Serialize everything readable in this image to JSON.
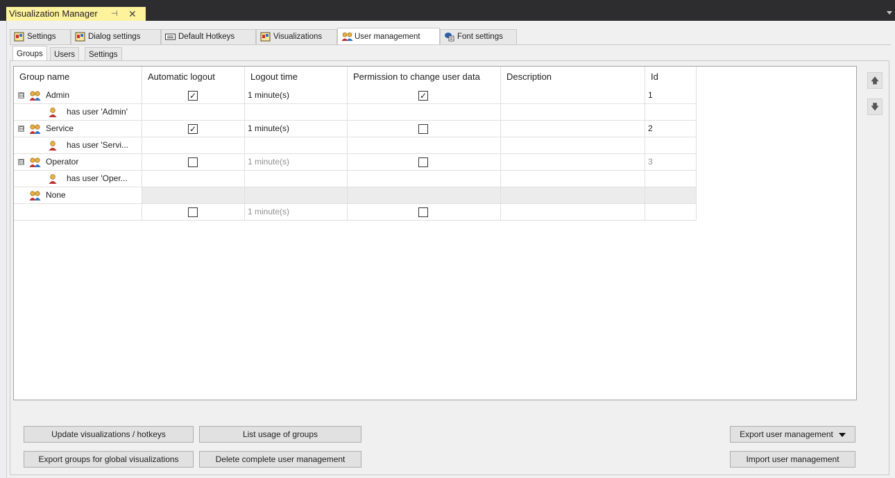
{
  "window": {
    "doc_tab_title": "Visualization Manager",
    "pin_glyph": "⊣",
    "close_glyph": "✕"
  },
  "top_tabs": [
    {
      "label": "Settings",
      "icon": "visualization-settings-icon"
    },
    {
      "label": "Dialog settings",
      "icon": "dialog-settings-icon"
    },
    {
      "label": "Default Hotkeys",
      "icon": "keyboard-icon"
    },
    {
      "label": "Visualizations",
      "icon": "visualizations-icon"
    },
    {
      "label": "User management",
      "icon": "user-group-icon",
      "active": true
    },
    {
      "label": "Font settings",
      "icon": "font-settings-icon"
    }
  ],
  "sub_tabs": [
    {
      "label": "Groups",
      "active": true
    },
    {
      "label": "Users"
    },
    {
      "label": "Settings"
    }
  ],
  "grid": {
    "columns": [
      "Group name",
      "Automatic logout",
      "Logout time",
      "Permission to change user data",
      "Description",
      "Id"
    ],
    "rows": [
      {
        "type": "group",
        "expander": "⊟",
        "name": "Admin",
        "auto_logout": true,
        "logout_time": "1 minute(s)",
        "perm_change": true,
        "description": "",
        "id": "1",
        "dim": false
      },
      {
        "type": "user",
        "name": "has user 'Admin'"
      },
      {
        "type": "group",
        "expander": "⊟",
        "name": "Service",
        "auto_logout": true,
        "logout_time": "1 minute(s)",
        "perm_change": false,
        "description": "",
        "id": "2",
        "dim": false
      },
      {
        "type": "user",
        "name": "has user 'Servi..."
      },
      {
        "type": "group",
        "expander": "⊟",
        "name": "Operator",
        "auto_logout": false,
        "logout_time": "1 minute(s)",
        "perm_change": false,
        "description": "",
        "id": "3",
        "dim": true
      },
      {
        "type": "user",
        "name": "has user 'Oper..."
      },
      {
        "type": "none",
        "name": "None"
      },
      {
        "type": "new",
        "auto_logout": false,
        "logout_time": "1 minute(s)",
        "perm_change": false
      }
    ],
    "check_glyph": "✓"
  },
  "side_buttons": {
    "up_glyph": "🡅",
    "down_glyph": "🡇"
  },
  "buttons": {
    "update_visualizations": "Update visualizations / hotkeys",
    "list_usage": "List usage of groups",
    "export_groups": "Export groups for global visualizations",
    "delete_all": "Delete complete user management",
    "export_um": "Export user management",
    "import_um": "Import user management"
  },
  "colors": {
    "doc_tab_accent": "#fff29d",
    "titlebar": "#2d2d30"
  }
}
